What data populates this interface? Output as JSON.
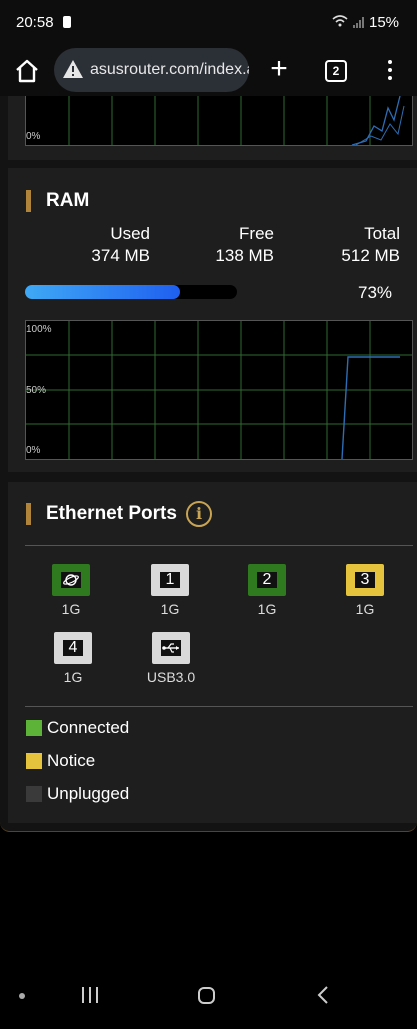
{
  "status_bar": {
    "time": "20:58",
    "battery": "15%"
  },
  "browser": {
    "url": "asusrouter.com/index.a",
    "tab_count": "2"
  },
  "cpu_graph": {
    "min_label": "0%"
  },
  "ram": {
    "title": "RAM",
    "used_label": "Used",
    "used_value": "374 MB",
    "free_label": "Free",
    "free_value": "138 MB",
    "total_label": "Total",
    "total_value": "512 MB",
    "percent": 73,
    "percent_label": "73%",
    "graph_labels": {
      "top": "100%",
      "mid": "50%",
      "bottom": "0%"
    }
  },
  "ethernet": {
    "title": "Ethernet Ports",
    "ports": [
      {
        "glyph": "globe-icon",
        "label": "1G",
        "status": "connected"
      },
      {
        "glyph": "1",
        "label": "1G",
        "status": "unplugged"
      },
      {
        "glyph": "2",
        "label": "1G",
        "status": "connected"
      },
      {
        "glyph": "3",
        "label": "1G",
        "status": "notice"
      },
      {
        "glyph": "4",
        "label": "1G",
        "status": "unplugged"
      },
      {
        "glyph": "usb-icon",
        "label": "USB3.0",
        "status": "unplugged"
      }
    ],
    "legend": [
      {
        "label": "Connected",
        "color": "#5cb338"
      },
      {
        "label": "Notice",
        "color": "#e6c33d"
      },
      {
        "label": "Unplugged",
        "color": "#3a3a3a"
      }
    ]
  },
  "colors": {
    "connected": "#2f7a1f",
    "notice": "#e6c33d",
    "unplugged": "#d9d9d9",
    "section_accent": "#b0843a",
    "progress_start": "#3fa9f5",
    "progress_end": "#1f5ff0",
    "graph_line": "#2e6db4",
    "grid": "#2f6a2f"
  }
}
